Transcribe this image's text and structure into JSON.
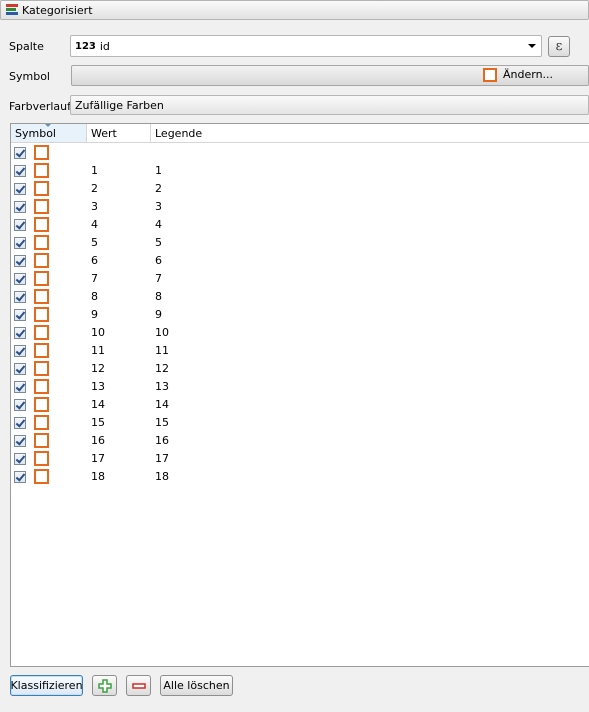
{
  "header": {
    "renderer": "Kategorisiert"
  },
  "column": {
    "label": "Spalte",
    "type_badge": "123",
    "value": "id",
    "expression_icon": "ε"
  },
  "symbol": {
    "label": "Symbol",
    "change_label": "Ändern..."
  },
  "color_ramp": {
    "label": "Farbverlauf",
    "value": "Zufällige Farben"
  },
  "table": {
    "columns": [
      "Symbol",
      "Wert",
      "Legende"
    ],
    "rows": [
      {
        "value": "",
        "legend": ""
      },
      {
        "value": "1",
        "legend": "1"
      },
      {
        "value": "2",
        "legend": "2"
      },
      {
        "value": "3",
        "legend": "3"
      },
      {
        "value": "4",
        "legend": "4"
      },
      {
        "value": "5",
        "legend": "5"
      },
      {
        "value": "6",
        "legend": "6"
      },
      {
        "value": "7",
        "legend": "7"
      },
      {
        "value": "8",
        "legend": "8"
      },
      {
        "value": "9",
        "legend": "9"
      },
      {
        "value": "10",
        "legend": "10"
      },
      {
        "value": "11",
        "legend": "11"
      },
      {
        "value": "12",
        "legend": "12"
      },
      {
        "value": "13",
        "legend": "13"
      },
      {
        "value": "14",
        "legend": "14"
      },
      {
        "value": "15",
        "legend": "15"
      },
      {
        "value": "16",
        "legend": "16"
      },
      {
        "value": "17",
        "legend": "17"
      },
      {
        "value": "18",
        "legend": "18"
      }
    ]
  },
  "buttons": {
    "classify": "Klassifizieren",
    "add": "+",
    "remove": "−",
    "delete_all": "Alle löschen"
  },
  "colors": {
    "symbol_outline": "#e4691e",
    "add_icon": "#3aa33a",
    "remove_icon": "#d02a2a",
    "checkbox_check": "#2c4f86"
  }
}
